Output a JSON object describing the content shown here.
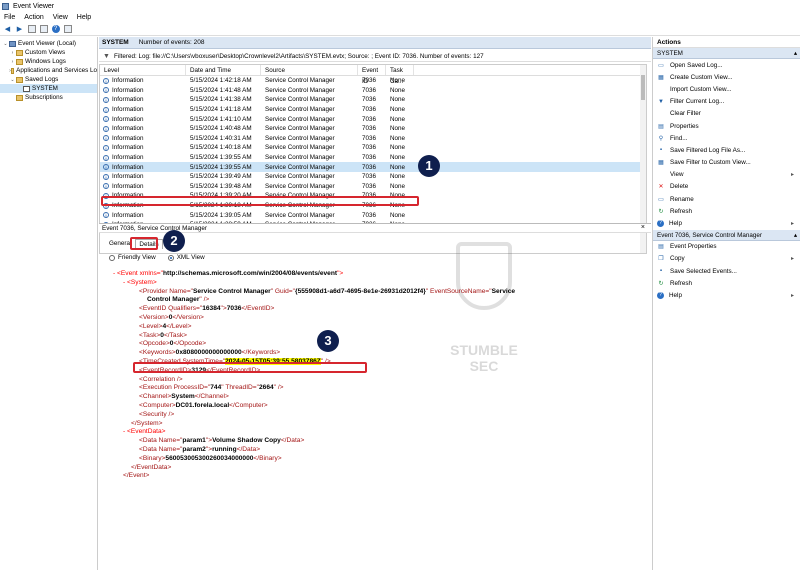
{
  "window": {
    "title": "Event Viewer"
  },
  "menu": [
    "File",
    "Action",
    "View",
    "Help"
  ],
  "tree": [
    {
      "label": "Event Viewer (Local)",
      "level": 0,
      "twisty": "⌄",
      "icon": "event-viewer-icon"
    },
    {
      "label": "Custom Views",
      "level": 1,
      "twisty": "›",
      "icon": "folder-icon"
    },
    {
      "label": "Windows Logs",
      "level": 1,
      "twisty": "›",
      "icon": "folder-icon"
    },
    {
      "label": "Applications and Services Lo",
      "level": 1,
      "twisty": "›",
      "icon": "folder-icon"
    },
    {
      "label": "Saved Logs",
      "level": 1,
      "twisty": "⌄",
      "icon": "folder-icon"
    },
    {
      "label": "SYSTEM",
      "level": 2,
      "twisty": "",
      "icon": "log-icon",
      "selected": true
    },
    {
      "label": "Subscriptions",
      "level": 1,
      "twisty": "",
      "icon": "subscription-icon"
    }
  ],
  "section": {
    "name": "SYSTEM",
    "count_text": "Number of events: 208"
  },
  "filter_text": "Filtered: Log: file://C:\\Users\\vboxuser\\Desktop\\Crownlevel2\\Artifacts\\SYSTEM.evtx; Source: ; Event ID: 7036. Number of events: 127",
  "grid": {
    "columns": [
      "Level",
      "Date and Time",
      "Source",
      "Event ID",
      "Task Ca..."
    ],
    "rows": [
      {
        "level": "Information",
        "date": "5/15/2024 1:42:18 AM",
        "source": "Service Control Manager",
        "id": "7036",
        "task": "None"
      },
      {
        "level": "Information",
        "date": "5/15/2024 1:41:48 AM",
        "source": "Service Control Manager",
        "id": "7036",
        "task": "None"
      },
      {
        "level": "Information",
        "date": "5/15/2024 1:41:38 AM",
        "source": "Service Control Manager",
        "id": "7036",
        "task": "None"
      },
      {
        "level": "Information",
        "date": "5/15/2024 1:41:18 AM",
        "source": "Service Control Manager",
        "id": "7036",
        "task": "None"
      },
      {
        "level": "Information",
        "date": "5/15/2024 1:41:10 AM",
        "source": "Service Control Manager",
        "id": "7036",
        "task": "None"
      },
      {
        "level": "Information",
        "date": "5/15/2024 1:40:48 AM",
        "source": "Service Control Manager",
        "id": "7036",
        "task": "None"
      },
      {
        "level": "Information",
        "date": "5/15/2024 1:40:31 AM",
        "source": "Service Control Manager",
        "id": "7036",
        "task": "None"
      },
      {
        "level": "Information",
        "date": "5/15/2024 1:40:18 AM",
        "source": "Service Control Manager",
        "id": "7036",
        "task": "None"
      },
      {
        "level": "Information",
        "date": "5/15/2024 1:39:55 AM",
        "source": "Service Control Manager",
        "id": "7036",
        "task": "None"
      },
      {
        "level": "Information",
        "date": "5/15/2024 1:39:55 AM",
        "source": "Service Control Manager",
        "id": "7036",
        "task": "None",
        "selected": true
      },
      {
        "level": "Information",
        "date": "5/15/2024 1:39:49 AM",
        "source": "Service Control Manager",
        "id": "7036",
        "task": "None"
      },
      {
        "level": "Information",
        "date": "5/15/2024 1:39:48 AM",
        "source": "Service Control Manager",
        "id": "7036",
        "task": "None"
      },
      {
        "level": "Information",
        "date": "5/15/2024 1:39:20 AM",
        "source": "Service Control Manager",
        "id": "7036",
        "task": "None"
      },
      {
        "level": "Information",
        "date": "5/15/2024 1:39:18 AM",
        "source": "Service Control Manager",
        "id": "7036",
        "task": "None"
      },
      {
        "level": "Information",
        "date": "5/15/2024 1:39:05 AM",
        "source": "Service Control Manager",
        "id": "7036",
        "task": "None"
      },
      {
        "level": "Information",
        "date": "5/15/2024 1:38:59 AM",
        "source": "Service Control Manager",
        "id": "7036",
        "task": "None"
      }
    ]
  },
  "event_panel": {
    "title": "Event 7036, Service Control Manager",
    "close": "×"
  },
  "tabs": {
    "general": "General",
    "details": "Details"
  },
  "view_options": {
    "friendly": "Friendly View",
    "xml": "XML View"
  },
  "badges": [
    "1",
    "2",
    "3"
  ],
  "xml": {
    "l1_pre": "- <Event xmlns=\"",
    "l1_ns": "http://schemas.microsoft.com/win/2004/08/events/event",
    "l1_post": "\">",
    "l2": "- <System>",
    "l3_pre": "<Provider Name=\"",
    "l3_name": "Service Control Manager",
    "l3_mid": "\" Guid=\"",
    "l3_guid": "{555908d1-a6d7-4695-8e1e-26931d2012f4}",
    "l3_mid2": "\" EventSourceName=\"",
    "l3_src": "Service",
    "l3b": "Control Manager",
    "l3b_post": "\" />",
    "l4_pre": "<EventID Qualifiers=\"",
    "l4_q": "16384",
    "l4_mid": "\">",
    "l4_val": "7036",
    "l4_post": "</EventID>",
    "l5_pre": "<Version>",
    "l5_val": "0",
    "l5_post": "</Version>",
    "l6_pre": "<Level>",
    "l6_val": "4",
    "l6_post": "</Level>",
    "l7_pre": "<Task>",
    "l7_val": "0",
    "l7_post": "</Task>",
    "l8_pre": "<Opcode>",
    "l8_val": "0",
    "l8_post": "</Opcode>",
    "l9_pre": "<Keywords>",
    "l9_val": "0x8080000000000000",
    "l9_post": "</Keywords>",
    "l10_pre": "<TimeCreated SystemTime=\"",
    "l10_val": "2024-05-15T05:39:55.5803786Z",
    "l10_post": "\" />",
    "l11_pre": "<EventRecordID>",
    "l11_val": "3129",
    "l11_post": "</EventRecordID>",
    "l12": "<Correlation />",
    "l13_pre": "<Execution ProcessID=\"",
    "l13_pid": "744",
    "l13_mid": "\" ThreadID=\"",
    "l13_tid": "2664",
    "l13_post": "\" />",
    "l14_pre": "<Channel>",
    "l14_val": "System",
    "l14_post": "</Channel>",
    "l15_pre": "<Computer>",
    "l15_val": "DC01.forela.local",
    "l15_post": "</Computer>",
    "l16": "<Security />",
    "l17": "</System>",
    "l18": "- <EventData>",
    "l19_pre": "<Data Name=\"",
    "l19_name": "param1",
    "l19_mid": "\">",
    "l19_val": "Volume Shadow Copy",
    "l19_post": "</Data>",
    "l20_pre": "<Data Name=\"",
    "l20_name": "param2",
    "l20_mid": "\">",
    "l20_val": "running",
    "l20_post": "</Data>",
    "l21_pre": "<Binary>",
    "l21_val": "560053005300260034000000",
    "l21_post": "</Binary>",
    "l22": "</EventData>",
    "l23": "</Event>"
  },
  "watermark": "STUMBLE SEC",
  "actions": {
    "title": "Actions",
    "group1": "SYSTEM",
    "items1": [
      {
        "label": "Open Saved Log...",
        "icon": "folder-open-icon",
        "glyph": "▭"
      },
      {
        "label": "Create Custom View...",
        "icon": "create-view-icon",
        "glyph": "▦"
      },
      {
        "label": "Import Custom View...",
        "icon": "import-icon",
        "glyph": ""
      },
      {
        "label": "Filter Current Log...",
        "icon": "filter-icon",
        "glyph": "▼"
      },
      {
        "label": "Clear Filter",
        "icon": "clear-filter-icon",
        "glyph": ""
      },
      {
        "label": "Properties",
        "icon": "properties-icon",
        "glyph": "▤"
      },
      {
        "label": "Find...",
        "icon": "find-icon",
        "glyph": "⚲"
      },
      {
        "label": "Save Filtered Log File As...",
        "icon": "save-icon",
        "glyph": "▪"
      },
      {
        "label": "Save Filter to Custom View...",
        "icon": "save-filter-icon",
        "glyph": "▦"
      },
      {
        "label": "View",
        "icon": "view-icon",
        "glyph": "",
        "submenu": true
      },
      {
        "label": "Delete",
        "icon": "delete-icon",
        "glyph": "✕"
      },
      {
        "label": "Rename",
        "icon": "rename-icon",
        "glyph": "▭"
      },
      {
        "label": "Refresh",
        "icon": "refresh-icon",
        "glyph": "↻"
      },
      {
        "label": "Help",
        "icon": "help-icon",
        "glyph": "?",
        "submenu": true
      }
    ],
    "group2": "Event 7036, Service Control Manager",
    "items2": [
      {
        "label": "Event Properties",
        "icon": "event-properties-icon",
        "glyph": "▤"
      },
      {
        "label": "Copy",
        "icon": "copy-icon",
        "glyph": "❐",
        "submenu": true
      },
      {
        "label": "Save Selected Events...",
        "icon": "save-icon",
        "glyph": "▪"
      },
      {
        "label": "Refresh",
        "icon": "refresh-icon",
        "glyph": "↻"
      },
      {
        "label": "Help",
        "icon": "help-icon",
        "glyph": "?",
        "submenu": true
      }
    ]
  },
  "colors": {
    "highlight": "#d6262e",
    "badge": "#0f1f4e",
    "selection": "#cce4f7",
    "header": "#dbe6f3"
  }
}
